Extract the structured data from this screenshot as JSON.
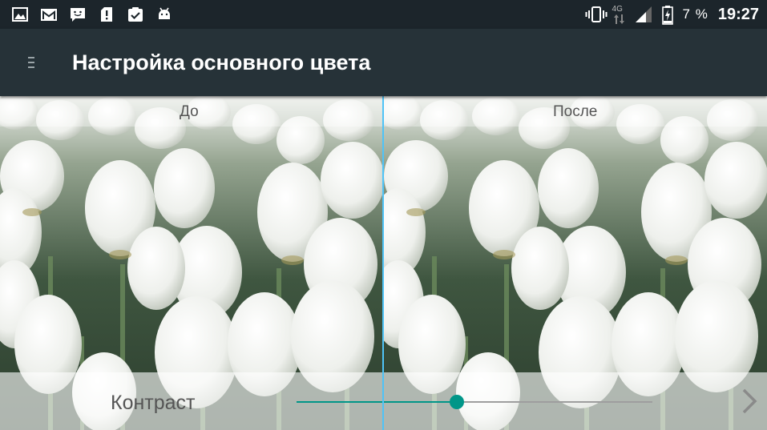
{
  "status_bar": {
    "notification_icons": [
      "image-icon",
      "gmail-icon",
      "chat-icon",
      "sd-card-alert-icon",
      "clipboard-check-icon",
      "android-icon"
    ],
    "network_type": "4G",
    "battery_percent": "7 %",
    "time": "19:27"
  },
  "app_bar": {
    "title": "Настройка основного цвета",
    "menu_icon": "menu-icon"
  },
  "compare": {
    "before_label": "До",
    "after_label": "После",
    "divider_color": "#4fc3f7"
  },
  "control": {
    "label": "Контраст",
    "slider_value": 0.45,
    "accent_color": "#009688",
    "next_icon": "chevron-right-icon"
  },
  "colors": {
    "status_bar_bg": "#1c252b",
    "app_bar_bg": "#263238"
  }
}
